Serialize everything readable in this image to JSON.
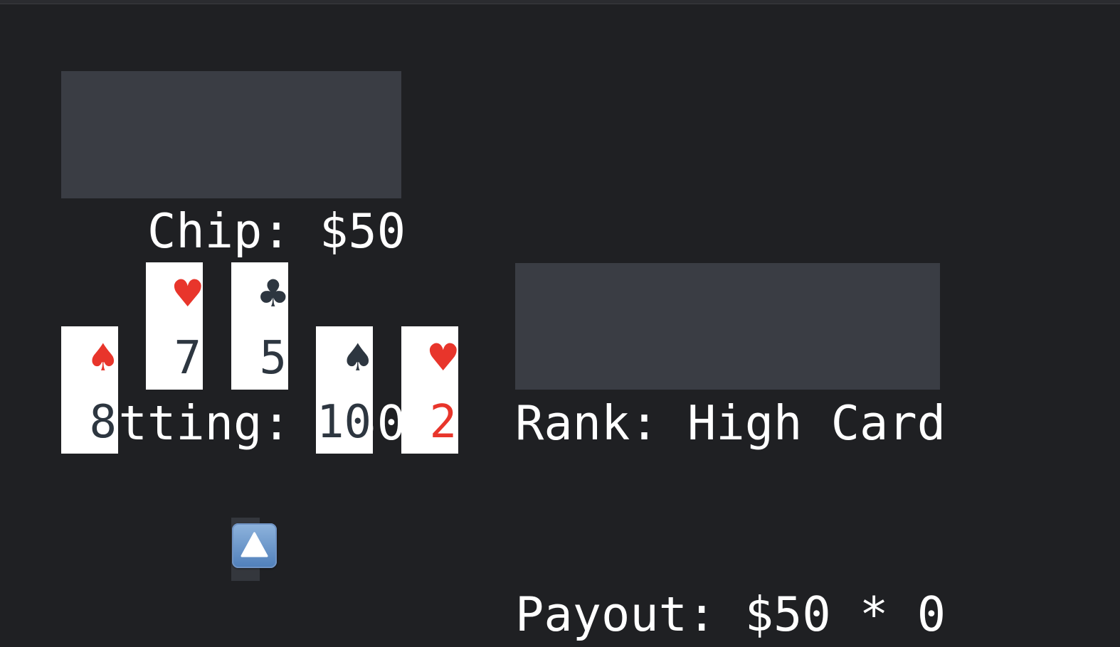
{
  "stake": {
    "chip": "   Chip: $50",
    "betting": "Betting: $50"
  },
  "hand": {
    "cards": [
      {
        "suit": "♠",
        "rank": "8",
        "color": "#2d3640",
        "raised": false
      },
      {
        "suit": "♥",
        "rank": "7",
        "color": "#e8352b",
        "raised": true
      },
      {
        "suit": "♣",
        "rank": "5",
        "color": "#2d3640",
        "raised": true
      },
      {
        "suit": "♠",
        "rank": "10",
        "color": "#2d3640",
        "raised": false
      },
      {
        "suit": "♥",
        "rank": "2",
        "color": "#e8352b",
        "raised": false
      }
    ],
    "cursor_card_index": 2
  },
  "result": {
    "rank": "Rank: High Card",
    "payout": "Payout: $50 * 0"
  },
  "controls": {
    "select_icon": "up-arrow-button-icon"
  },
  "colors": {
    "background": "#1f2023",
    "panel": "#3a3d44",
    "red_suit": "#e8352b",
    "black_suit": "#2d3640"
  }
}
